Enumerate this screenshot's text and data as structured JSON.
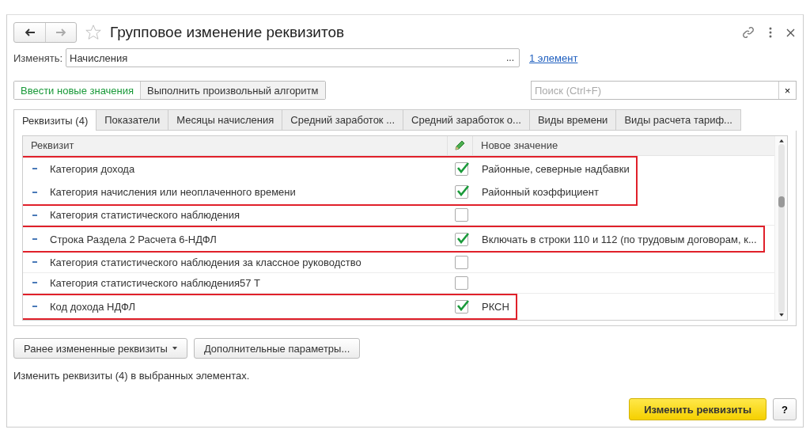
{
  "window": {
    "title": "Групповое изменение реквизитов",
    "favorite": false
  },
  "change": {
    "label": "Изменять:",
    "value": "Начисления",
    "choose": "...",
    "link": "1 элемент"
  },
  "modes": [
    {
      "label": "Ввести новые значения",
      "selected": true
    },
    {
      "label": "Выполнить произвольный алгоритм",
      "selected": false
    }
  ],
  "search": {
    "placeholder": "Поиск (Ctrl+F)",
    "clear": "×"
  },
  "tabs": [
    {
      "label": "Реквизиты (4)",
      "selected": true
    },
    {
      "label": "Показатели",
      "selected": false
    },
    {
      "label": "Месяцы начисления",
      "selected": false
    },
    {
      "label": "Средний заработок ...",
      "selected": false
    },
    {
      "label": "Средний заработок о...",
      "selected": false
    },
    {
      "label": "Виды времени",
      "selected": false
    },
    {
      "label": "Виды расчета тариф...",
      "selected": false
    }
  ],
  "table": {
    "columns": [
      "Реквизит",
      "Новое значение"
    ],
    "rows": [
      {
        "name": "Категория дохода",
        "checked": true,
        "value": "Районные, северные надбавки",
        "highlighted": true
      },
      {
        "name": "Категория начисления или неоплаченного времени",
        "checked": true,
        "value": "Районный коэффициент",
        "highlighted": true
      },
      {
        "name": "Категория статистического наблюдения",
        "checked": false,
        "highlighted": false
      },
      {
        "name": "Строка Раздела 2 Расчета 6-НДФЛ",
        "checked": true,
        "value": "Включать в строки 110 и 112 (по трудовым договорам, к...",
        "highlighted": true
      },
      {
        "name": "Категория статистического наблюдения за классное руководство",
        "checked": false,
        "highlighted": false
      },
      {
        "name": "Категория статистического наблюдения57 Т",
        "checked": false,
        "highlighted": false
      },
      {
        "name": "Код дохода НДФЛ",
        "checked": true,
        "value": "РКСН",
        "highlighted": true
      }
    ]
  },
  "bottom_buttons": [
    "Ранее измененные реквизиты",
    "Дополнительные параметры..."
  ],
  "status": "Изменить реквизиты (4) в выбранных элементах.",
  "footer": {
    "primary": "Изменить реквизиты",
    "help": "?"
  }
}
